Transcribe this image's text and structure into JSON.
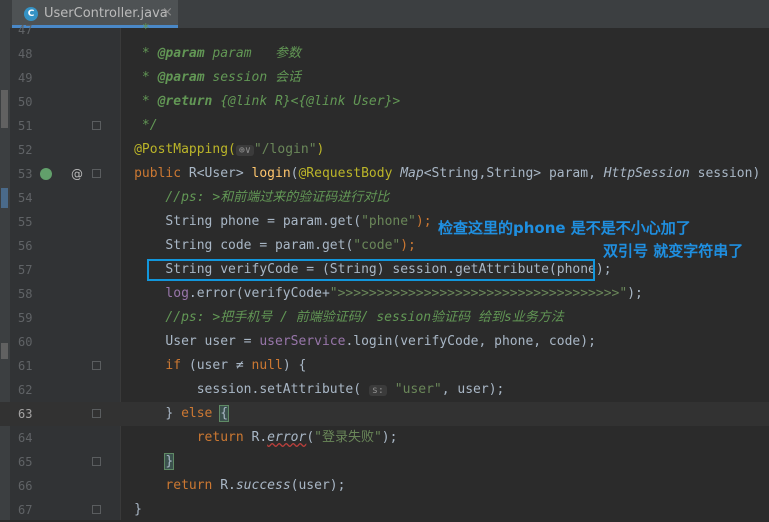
{
  "tab": {
    "file_name": "UserController.java",
    "icon_letter": "C",
    "close": "×"
  },
  "lines": [
    {
      "num": "47",
      "tokens": [
        {
          "t": "     *",
          "c": "cm"
        }
      ]
    },
    {
      "num": "48",
      "tokens": [
        {
          "t": "     * ",
          "c": "cm"
        },
        {
          "t": "@param",
          "c": "tag"
        },
        {
          "t": " param   参数",
          "c": "cm"
        }
      ]
    },
    {
      "num": "49",
      "tokens": [
        {
          "t": "     * ",
          "c": "cm"
        },
        {
          "t": "@param",
          "c": "tag"
        },
        {
          "t": " session 会话",
          "c": "cm"
        }
      ]
    },
    {
      "num": "50",
      "tokens": [
        {
          "t": "     * ",
          "c": "cm"
        },
        {
          "t": "@return",
          "c": "tag"
        },
        {
          "t": " {@link R}<{@link User}>",
          "c": "cm"
        }
      ]
    },
    {
      "num": "51",
      "tokens": [
        {
          "t": "     */",
          "c": "cm"
        }
      ]
    },
    {
      "num": "52",
      "tokens": [
        {
          "t": "    @PostMapping(",
          "c": "ann"
        },
        {
          "t": "⊕∨",
          "c": "hint"
        },
        {
          "t": "\"/login\"",
          "c": "str"
        },
        {
          "t": ")",
          "c": "ann"
        }
      ]
    },
    {
      "num": "53",
      "tokens": [
        {
          "t": "    public ",
          "c": "kw"
        },
        {
          "t": "R<User> ",
          "c": "plain"
        },
        {
          "t": "login",
          "c": "fn"
        },
        {
          "t": "(",
          "c": "plain"
        },
        {
          "t": "@RequestBody ",
          "c": "ann"
        },
        {
          "t": "Map",
          "c": "plain it"
        },
        {
          "t": "<String,String> param, ",
          "c": "plain"
        },
        {
          "t": "HttpSession",
          "c": "plain it"
        },
        {
          "t": " session) {",
          "c": "plain"
        }
      ]
    },
    {
      "num": "54",
      "tokens": [
        {
          "t": "        //ps: >和前端过来的验证码进行对比",
          "c": "cm"
        }
      ]
    },
    {
      "num": "55",
      "tokens": [
        {
          "t": "        String phone = ",
          "c": "plain"
        },
        {
          "t": "param",
          "c": "plain"
        },
        {
          "t": ".",
          "c": "plain"
        },
        {
          "t": "get",
          "c": "plain"
        },
        {
          "t": "(",
          "c": "plain"
        },
        {
          "t": "\"phone\"",
          "c": "str"
        },
        {
          "t": ");",
          "c": "kw"
        }
      ]
    },
    {
      "num": "56",
      "tokens": [
        {
          "t": "        String code = ",
          "c": "plain"
        },
        {
          "t": "param",
          "c": "plain"
        },
        {
          "t": ".",
          "c": "plain"
        },
        {
          "t": "get",
          "c": "plain"
        },
        {
          "t": "(",
          "c": "plain"
        },
        {
          "t": "\"code\"",
          "c": "str"
        },
        {
          "t": ");",
          "c": "kw"
        }
      ]
    },
    {
      "num": "57",
      "tokens": [
        {
          "t": "        String verifyCode = (String) session.",
          "c": "plain"
        },
        {
          "t": "getAttribute",
          "c": "plain"
        },
        {
          "t": "(phone);",
          "c": "plain"
        }
      ]
    },
    {
      "num": "58",
      "tokens": [
        {
          "t": "        log",
          "c": "fld"
        },
        {
          "t": ".error(verifyCode+",
          "c": "plain"
        },
        {
          "t": "\">>>>>>>>>>>>>>>>>>>>>>>>>>>>>>>>>>>>\"",
          "c": "str"
        },
        {
          "t": ");",
          "c": "plain"
        }
      ]
    },
    {
      "num": "59",
      "tokens": [
        {
          "t": "        //ps: >把手机号 / 前端验证码/ session验证码 给到s业务方法",
          "c": "cm"
        }
      ]
    },
    {
      "num": "60",
      "tokens": [
        {
          "t": "        User user = ",
          "c": "plain"
        },
        {
          "t": "userService",
          "c": "fld"
        },
        {
          "t": ".login(verifyCode, phone, code);",
          "c": "plain"
        }
      ]
    },
    {
      "num": "61",
      "tokens": [
        {
          "t": "        if ",
          "c": "kw"
        },
        {
          "t": "(user ≠ ",
          "c": "plain"
        },
        {
          "t": "null",
          "c": "kw"
        },
        {
          "t": ") {",
          "c": "plain"
        }
      ]
    },
    {
      "num": "62",
      "tokens": [
        {
          "t": "            session.setAttribute( ",
          "c": "plain"
        },
        {
          "t": "s:",
          "c": "hint"
        },
        {
          "t": " \"user\"",
          "c": "str"
        },
        {
          "t": ", user);",
          "c": "plain"
        }
      ]
    },
    {
      "num": "63",
      "tokens": [
        {
          "t": "        } ",
          "c": "plain"
        },
        {
          "t": "else ",
          "c": "kw"
        },
        {
          "t": "{",
          "c": "plain brace"
        }
      ]
    },
    {
      "num": "64",
      "tokens": [
        {
          "t": "            return ",
          "c": "kw"
        },
        {
          "t": "R.",
          "c": "plain"
        },
        {
          "t": "error",
          "c": "plain it squig"
        },
        {
          "t": "(",
          "c": "plain"
        },
        {
          "t": "\"登录失败\"",
          "c": "str"
        },
        {
          "t": ");",
          "c": "plain"
        }
      ]
    },
    {
      "num": "65",
      "tokens": [
        {
          "t": "        ",
          "c": "plain"
        },
        {
          "t": "}",
          "c": "plain brace"
        }
      ]
    },
    {
      "num": "66",
      "tokens": [
        {
          "t": "        return ",
          "c": "kw"
        },
        {
          "t": "R.",
          "c": "plain"
        },
        {
          "t": "success",
          "c": "plain it"
        },
        {
          "t": "(user);",
          "c": "plain"
        }
      ]
    },
    {
      "num": "67",
      "tokens": [
        {
          "t": "    }",
          "c": "plain"
        }
      ]
    }
  ],
  "current_line": "63",
  "annotation": {
    "line1": "检查这里的phone 是不是不小心加了",
    "line2": "双引号 就变字符串了"
  },
  "colors": {
    "accent": "#1296db",
    "annotation_text": "#1f8fe0"
  }
}
